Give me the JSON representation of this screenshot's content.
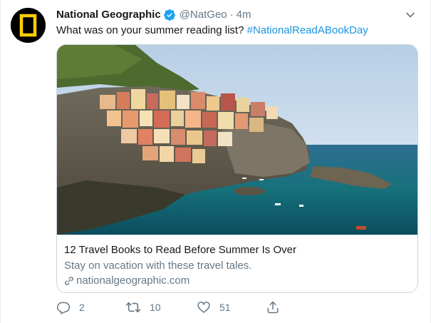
{
  "tweet": {
    "author": {
      "name": "National Geographic",
      "handle": "@NatGeo",
      "verified": true
    },
    "separator": "·",
    "timestamp": "4m",
    "text_plain": "What was on your summer reading list? ",
    "hashtag": "#NationalReadABookDay"
  },
  "card": {
    "title": "12 Travel Books to Read Before Summer Is Over",
    "description": "Stay on vacation with these travel tales.",
    "domain": "nationalgeographic.com",
    "image_icon": "coastal-village-photo"
  },
  "actions": {
    "reply": {
      "icon": "reply-icon",
      "count": "2"
    },
    "retweet": {
      "icon": "retweet-icon",
      "count": "10"
    },
    "like": {
      "icon": "heart-icon",
      "count": "51"
    },
    "share": {
      "icon": "share-icon"
    }
  },
  "colors": {
    "accent": "#1b95e0",
    "verified": "#1da1f2",
    "secondary_text": "#657786",
    "border": "#ccd6dd",
    "brand_yellow": "#ffce00"
  }
}
